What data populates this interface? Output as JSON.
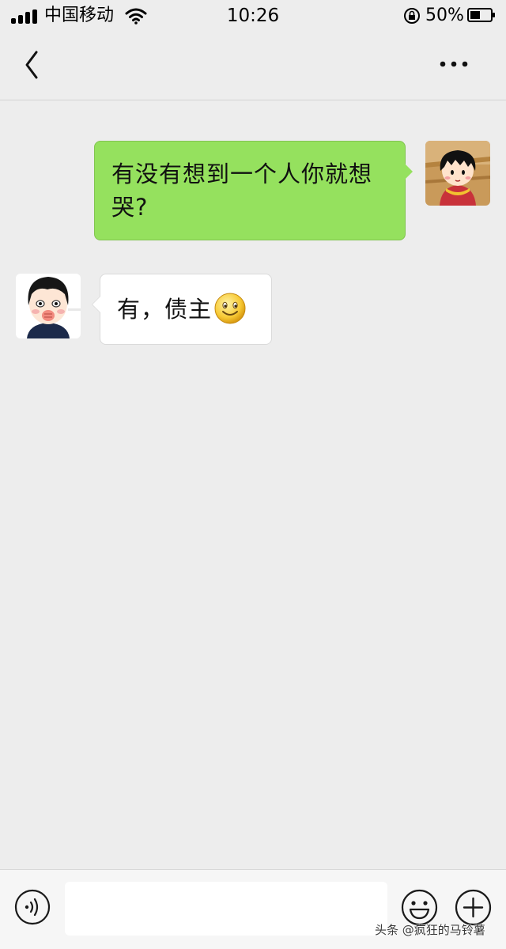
{
  "status_bar": {
    "carrier": "中国移动",
    "time": "10:26",
    "battery": "50%",
    "battery_level": 0.5,
    "icons": [
      "signal-icon",
      "wifi-icon",
      "rotation-lock-icon",
      "battery-icon"
    ]
  },
  "nav": {
    "back_icon": "chevron-left-icon",
    "more_icon": "more-dots-icon"
  },
  "messages": [
    {
      "direction": "outgoing",
      "text": "有没有想到一个人你就想哭?"
    },
    {
      "direction": "incoming",
      "text": "有，债主",
      "emoji": "smile-emoji"
    }
  ],
  "input_bar": {
    "message_value": "",
    "icons": [
      "voice-icon",
      "emoji-icon",
      "plus-icon"
    ]
  },
  "watermark": "头条 @疯狂的马铃薯",
  "colors": {
    "background": "#ededed",
    "outgoing_bubble": "#95e15e",
    "incoming_bubble": "#ffffff"
  }
}
